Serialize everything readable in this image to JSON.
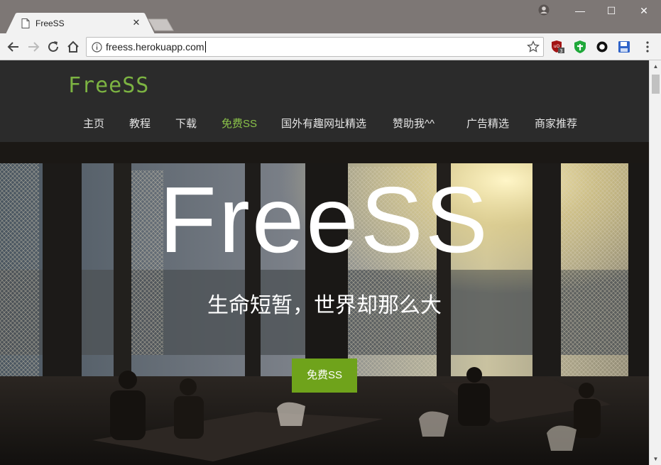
{
  "browser": {
    "tab_title": "FreeSS",
    "tab_close": "✕",
    "url": "freess.herokuapp.com",
    "window_controls": {
      "minimize": "—",
      "maximize": "☐",
      "close": "✕"
    },
    "extension_badge": "3"
  },
  "site": {
    "brand": "FreeSS",
    "nav": [
      {
        "label": "主页"
      },
      {
        "label": "教程"
      },
      {
        "label": "下载"
      },
      {
        "label": "免费SS",
        "active": true
      },
      {
        "label": "国外有趣网址精选"
      },
      {
        "label": "赞助我^^"
      },
      {
        "label": "广告精选"
      },
      {
        "label": "商家推荐"
      }
    ],
    "hero": {
      "title": "FreeSS",
      "subtitle": "生命短暂，世界却那么大",
      "button": "免费SS"
    }
  },
  "colors": {
    "brand_green": "#7cb342",
    "button_green": "#6fa31b",
    "header_bg": "#2b2b2b"
  }
}
